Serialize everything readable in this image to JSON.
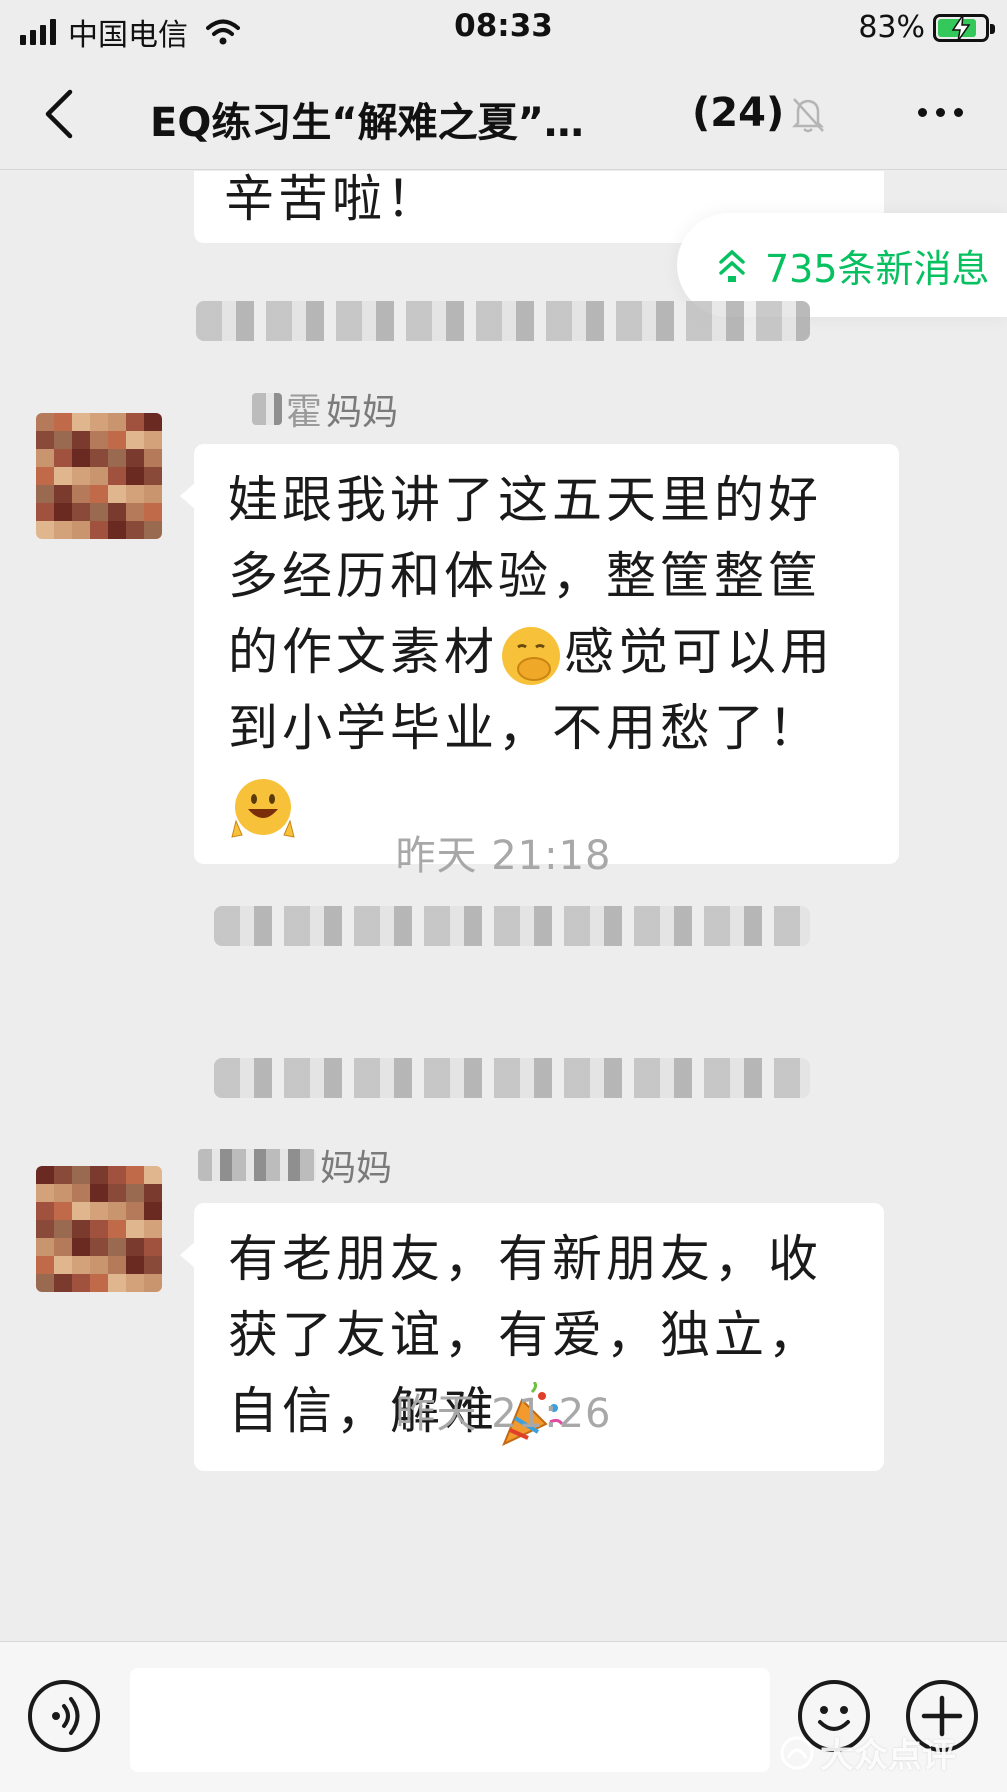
{
  "status_bar": {
    "carrier": "中国电信",
    "time": "08:33",
    "battery": "83%",
    "battery_level": 0.83
  },
  "nav": {
    "title": "EQ练习生“解难之夏”…",
    "member_count": "(24)"
  },
  "chat": {
    "partial_message": "辛苦啦！",
    "new_messages": "735条新消息",
    "messages": [
      {
        "sender": "妈妈",
        "sender_prefix": "霍",
        "text": "娃跟我讲了这五天里的好多经历和体验，整筐整筐的作文素材",
        "text_after_emoji": "感觉可以用到小学毕业，不用愁了！"
      },
      {
        "sender": "妈妈",
        "text": "有老朋友，有新朋友，收获了友谊，有爱，独立，自信，解难"
      }
    ],
    "timestamps": [
      "昨天 21:18",
      "昨天 21:26"
    ]
  },
  "icons": {
    "back": "chevron-left-icon",
    "mute": "bell-slash-icon",
    "more": "more-dots-icon",
    "voice": "voice-icon",
    "emoji": "emoji-icon",
    "plus": "plus-icon"
  },
  "accent_color": "#07c160",
  "watermark": "大众点评"
}
